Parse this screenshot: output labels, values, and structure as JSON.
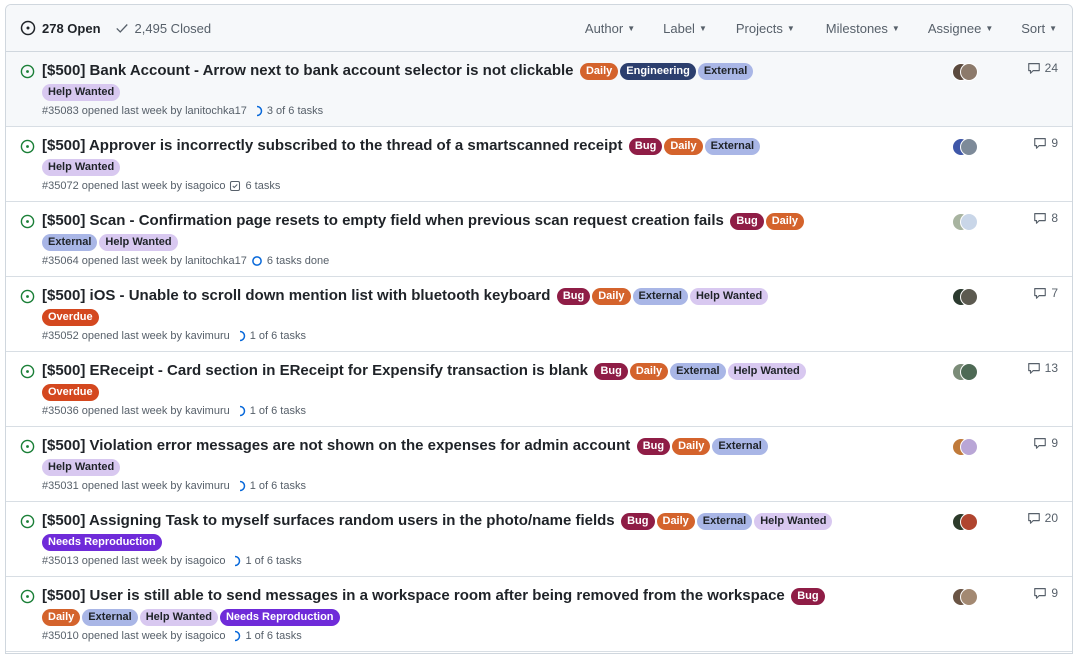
{
  "header": {
    "open_label": "278 Open",
    "closed_label": "2,495 Closed",
    "filters": [
      "Author",
      "Label",
      "Projects",
      "Milestones",
      "Assignee",
      "Sort"
    ]
  },
  "colors": {
    "Daily": "#d4632c",
    "Engineering": "#2c3f6e",
    "External": "#a9b6e6",
    "Help Wanted": "#d8c8f0",
    "Bug": "#8f1d46",
    "Overdue": "#d4481f",
    "Needs Reproduction": "#6f2bd9"
  },
  "issues": [
    {
      "title": "[$500] Bank Account - Arrow next to bank account selector is not clickable",
      "inline_labels": [
        "Daily",
        "Engineering",
        "External"
      ],
      "extra_labels": [
        "Help Wanted"
      ],
      "meta": "#35083 opened last week by lanitochka17",
      "tasks": "3 of 6 tasks",
      "task_icon": "progress-icon",
      "comments": "24"
    },
    {
      "title": "[$500] Approver is incorrectly subscribed to the thread of a smartscanned receipt",
      "inline_labels": [
        "Bug",
        "Daily",
        "External"
      ],
      "extra_labels": [
        "Help Wanted"
      ],
      "meta": "#35072 opened last week by isagoico",
      "tasks": "6 tasks",
      "task_icon": "checklist-icon",
      "comments": "9"
    },
    {
      "title": "[$500] Scan - Confirmation page resets to empty field when previous scan request creation fails",
      "inline_labels": [
        "Bug",
        "Daily"
      ],
      "extra_labels": [
        "External",
        "Help Wanted"
      ],
      "meta": "#35064 opened last week by lanitochka17",
      "tasks": "6 tasks done",
      "task_icon": "circle-icon",
      "comments": "8"
    },
    {
      "title": "[$500] iOS - Unable to scroll down mention list with bluetooth keyboard",
      "inline_labels": [
        "Bug",
        "Daily",
        "External",
        "Help Wanted"
      ],
      "extra_labels": [
        "Overdue"
      ],
      "meta": "#35052 opened last week by kavimuru",
      "tasks": "1 of 6 tasks",
      "task_icon": "progress-icon",
      "comments": "7"
    },
    {
      "title": "[$500] EReceipt - Card section in EReceipt for Expensify transaction is blank",
      "inline_labels": [
        "Bug",
        "Daily",
        "External",
        "Help Wanted"
      ],
      "extra_labels": [
        "Overdue"
      ],
      "meta": "#35036 opened last week by kavimuru",
      "tasks": "1 of 6 tasks",
      "task_icon": "progress-icon",
      "comments": "13"
    },
    {
      "title": "[$500] Violation error messages are not shown on the expenses for admin account",
      "inline_labels": [
        "Bug",
        "Daily",
        "External"
      ],
      "extra_labels": [
        "Help Wanted"
      ],
      "meta": "#35031 opened last week by kavimuru",
      "tasks": "1 of 6 tasks",
      "task_icon": "progress-icon",
      "comments": "9"
    },
    {
      "title": "[$500] Assigning Task to myself surfaces random users in the photo/name fields",
      "inline_labels": [
        "Bug",
        "Daily",
        "External",
        "Help Wanted"
      ],
      "extra_labels": [
        "Needs Reproduction"
      ],
      "meta": "#35013 opened last week by isagoico",
      "tasks": "1 of 6 tasks",
      "task_icon": "progress-icon",
      "comments": "20"
    },
    {
      "title": "[$500] User is still able to send messages in a workspace room after being removed from the workspace",
      "inline_labels": [
        "Bug"
      ],
      "extra_labels": [
        "Daily",
        "External",
        "Help Wanted",
        "Needs Reproduction"
      ],
      "meta": "#35010 opened last week by isagoico",
      "tasks": "1 of 6 tasks",
      "task_icon": "progress-icon",
      "comments": "9"
    }
  ]
}
